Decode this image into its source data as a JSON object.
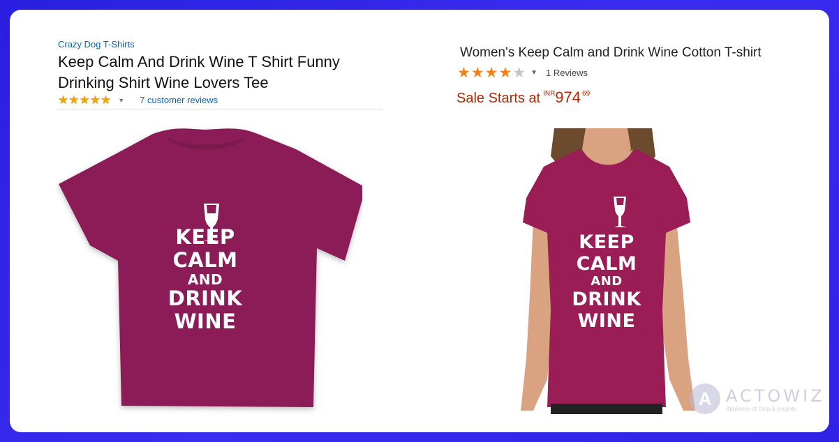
{
  "left_product": {
    "brand": "Crazy Dog T-Shirts",
    "title_line1": "Keep Calm And Drink Wine T Shirt Funny",
    "title_line2": "Drinking Shirt Wine Lovers Tee",
    "rating": 5,
    "reviews": "7 customer reviews",
    "shirt_color": "#8b1e58",
    "print_lines": [
      "KEEP",
      "CALM",
      "AND",
      "DRINK",
      "WINE"
    ]
  },
  "right_product": {
    "title": "Women's Keep Calm and Drink Wine Cotton T-shirt",
    "rating": 4,
    "reviews": "1 Reviews",
    "sale_label": "Sale Starts at",
    "currency": "INR",
    "price_whole": "974",
    "price_decimal": "69",
    "shirt_color": "#9b1d55",
    "print_lines": [
      "KEEP",
      "CALM",
      "AND",
      "DRINK",
      "WINE"
    ]
  },
  "watermark": {
    "logo_letter": "A",
    "name": "ACTOWIZ",
    "tagline": "Appliance of Data & Insights"
  },
  "colors": {
    "background": "#2f22e6",
    "amazon_star": "#f0a500",
    "flipkart_star": "#f57f17",
    "link": "#0066c0",
    "price": "#b12704"
  }
}
